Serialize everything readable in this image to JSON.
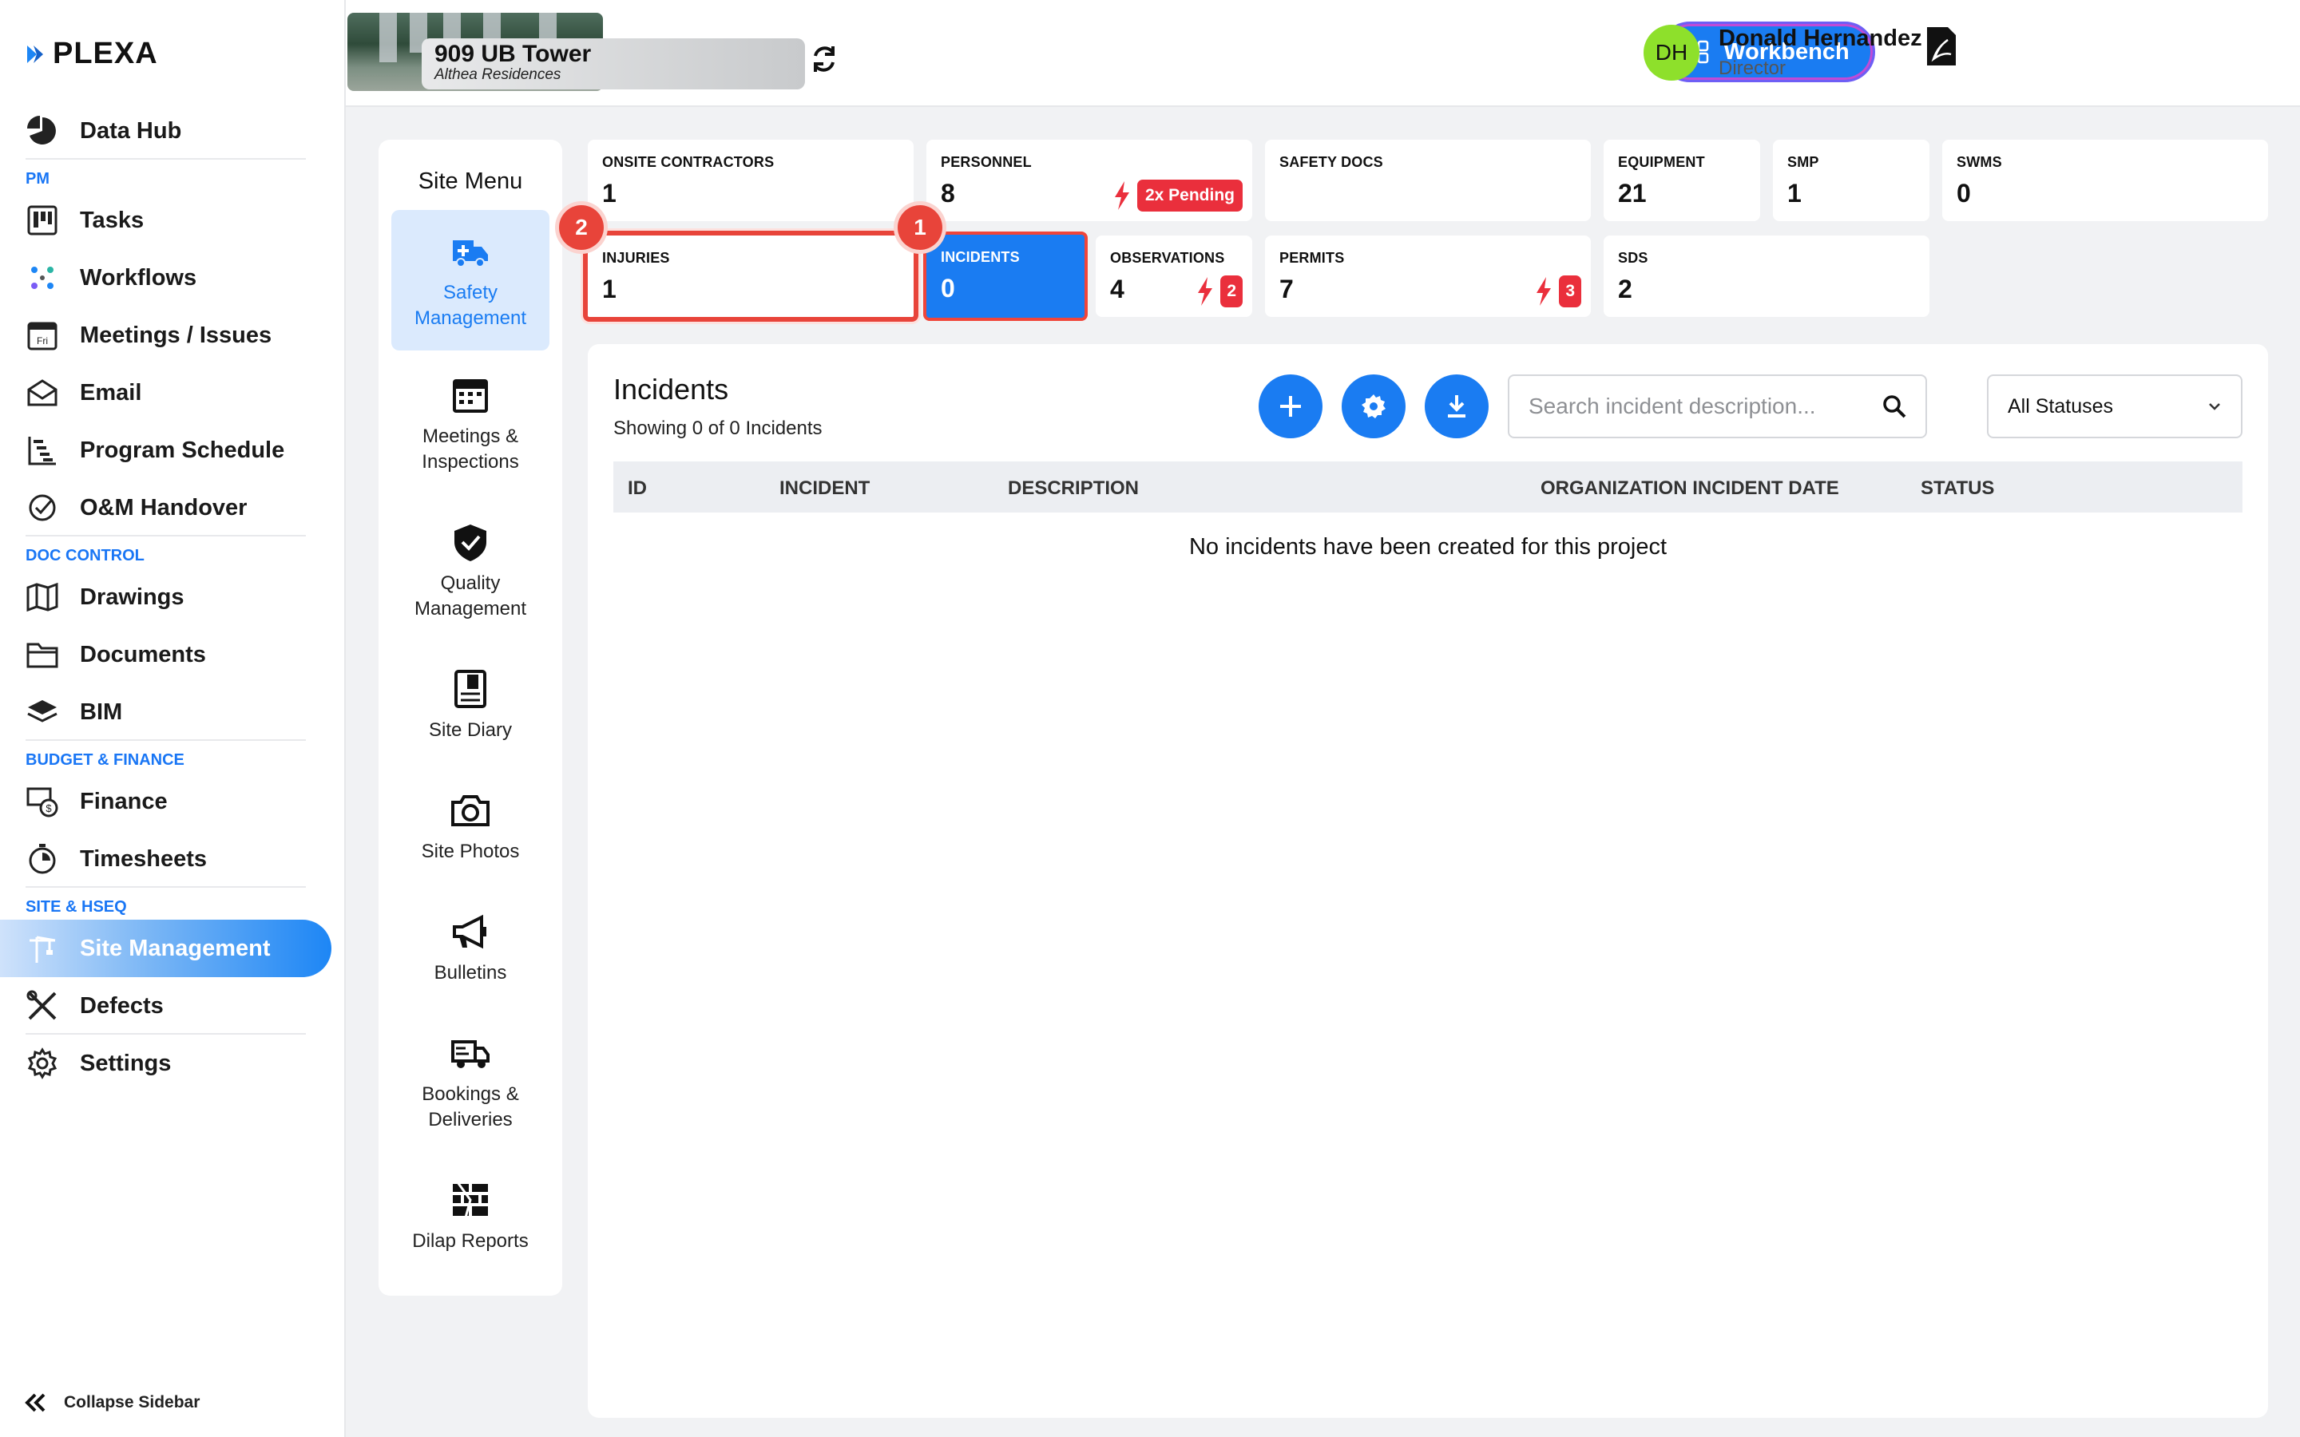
{
  "app": {
    "logo": "PLEXA"
  },
  "sidebar": {
    "items": [
      {
        "label": "Data Hub",
        "icon": "pie-chart-icon"
      },
      {
        "section": "PM"
      },
      {
        "label": "Tasks",
        "icon": "kanban-icon"
      },
      {
        "label": "Workflows",
        "icon": "workflow-icon"
      },
      {
        "label": "Meetings / Issues",
        "icon": "calendar-icon"
      },
      {
        "label": "Email",
        "icon": "email-icon"
      },
      {
        "label": "Program Schedule",
        "icon": "gantt-icon"
      },
      {
        "label": "O&M Handover",
        "icon": "check-circle-icon"
      },
      {
        "section": "DOC CONTROL"
      },
      {
        "label": "Drawings",
        "icon": "map-icon"
      },
      {
        "label": "Documents",
        "icon": "folder-icon"
      },
      {
        "label": "BIM",
        "icon": "layers-icon"
      },
      {
        "section": "BUDGET & FINANCE"
      },
      {
        "label": "Finance",
        "icon": "finance-icon"
      },
      {
        "label": "Timesheets",
        "icon": "stopwatch-icon"
      },
      {
        "section": "SITE & HSEQ"
      },
      {
        "label": "Site Management",
        "icon": "crane-icon",
        "active": true
      },
      {
        "label": "Defects",
        "icon": "tools-icon"
      },
      {
        "label": "Settings",
        "icon": "gear-icon"
      }
    ],
    "collapse_label": "Collapse Sidebar"
  },
  "header": {
    "project_name": "909 UB Tower",
    "project_sub": "Althea Residences",
    "workbench_label": "Workbench",
    "user_initials": "DH",
    "user_name": "Donald Hernandez",
    "user_role": "Director"
  },
  "site_menu": {
    "title": "Site Menu",
    "items": [
      {
        "label": "Safety Management",
        "icon": "ambulance-icon",
        "active": true
      },
      {
        "label": "Meetings & Inspections",
        "icon": "calendar-icon"
      },
      {
        "label": "Quality Management",
        "icon": "shield-check-icon"
      },
      {
        "label": "Site Diary",
        "icon": "diary-icon"
      },
      {
        "label": "Site Photos",
        "icon": "camera-icon"
      },
      {
        "label": "Bulletins",
        "icon": "megaphone-icon"
      },
      {
        "label": "Bookings & Deliveries",
        "icon": "truck-icon"
      },
      {
        "label": "Dilap Reports",
        "icon": "brick-wall-icon"
      }
    ]
  },
  "cards": {
    "onsite_contractors": {
      "title": "ONSITE CONTRACTORS",
      "value": "1"
    },
    "personnel": {
      "title": "PERSONNEL",
      "value": "8",
      "badge": "2x Pending"
    },
    "safety_docs": {
      "title": "SAFETY DOCS",
      "value": ""
    },
    "equipment": {
      "title": "EQUIPMENT",
      "value": "21"
    },
    "smp": {
      "title": "SMP",
      "value": "1"
    },
    "swms": {
      "title": "SWMS",
      "value": "0"
    },
    "injuries": {
      "title": "INJURIES",
      "value": "1",
      "marker": "2"
    },
    "incidents": {
      "title": "INCIDENTS",
      "value": "0",
      "marker": "1"
    },
    "observations": {
      "title": "OBSERVATIONS",
      "value": "4",
      "badge": "2"
    },
    "permits": {
      "title": "PERMITS",
      "value": "7",
      "badge": "3"
    },
    "sds": {
      "title": "SDS",
      "value": "2"
    }
  },
  "incidents": {
    "title": "Incidents",
    "subtitle": "Showing 0 of 0 Incidents",
    "search_placeholder": "Search incident description...",
    "status_filter": "All Statuses",
    "columns": [
      "ID",
      "INCIDENT",
      "DESCRIPTION",
      "ORGANIZATION INCIDENT DATE",
      "STATUS"
    ],
    "empty_message": "No incidents have been created for this project"
  },
  "colors": {
    "accent": "#1a7cf2",
    "alert": "#e8443a",
    "avatar": "#8ee02b"
  }
}
